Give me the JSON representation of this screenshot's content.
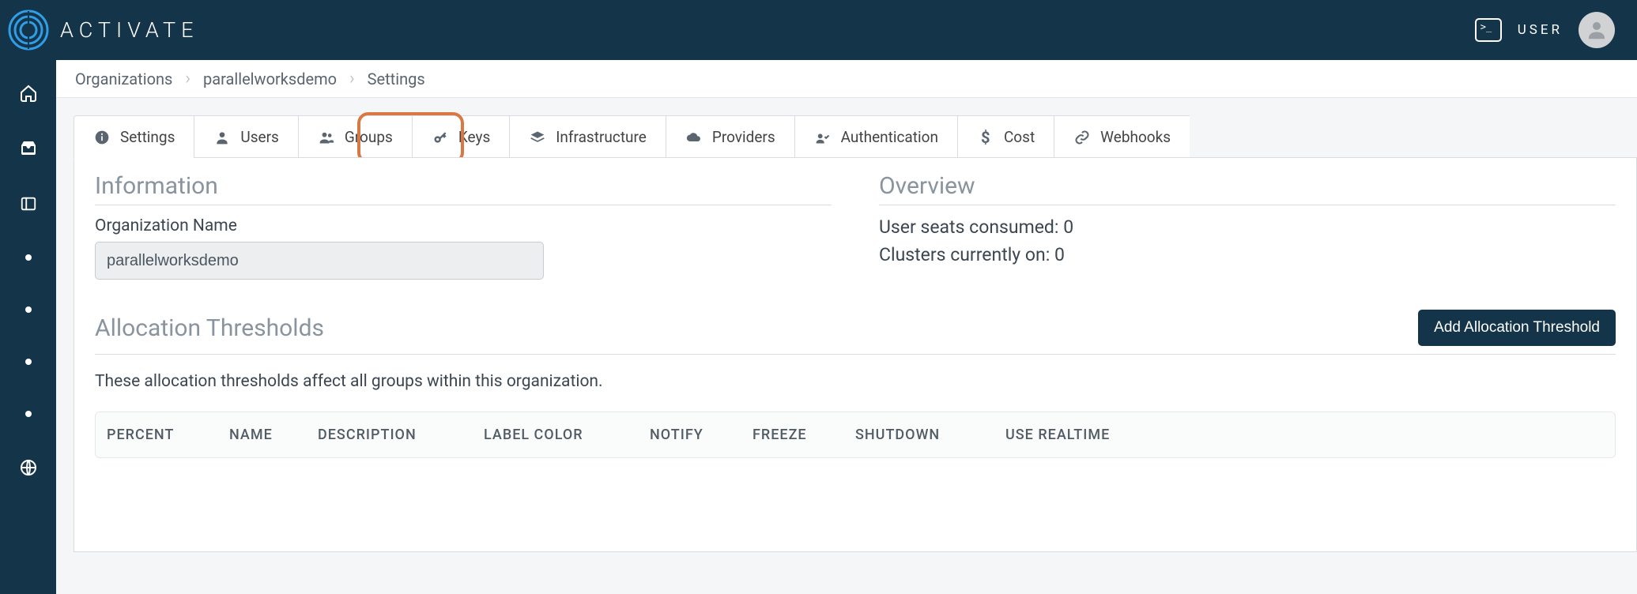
{
  "brand": {
    "name": "ACTIVATE"
  },
  "header": {
    "user_label": "USER"
  },
  "breadcrumb": {
    "items": [
      "Organizations",
      "parallelworksdemo",
      "Settings"
    ]
  },
  "tabs": [
    {
      "label": "Settings",
      "icon": "info"
    },
    {
      "label": "Users",
      "icon": "user"
    },
    {
      "label": "Groups",
      "icon": "users"
    },
    {
      "label": "Keys",
      "icon": "key"
    },
    {
      "label": "Infrastructure",
      "icon": "layers"
    },
    {
      "label": "Providers",
      "icon": "cloud"
    },
    {
      "label": "Authentication",
      "icon": "auth"
    },
    {
      "label": "Cost",
      "icon": "dollar"
    },
    {
      "label": "Webhooks",
      "icon": "link"
    }
  ],
  "information": {
    "title": "Information",
    "org_name_label": "Organization Name",
    "org_name_value": "parallelworksdemo"
  },
  "overview": {
    "title": "Overview",
    "seats_label": "User seats consumed:",
    "seats_value": "0",
    "clusters_label": "Clusters currently on:",
    "clusters_value": "0"
  },
  "thresholds": {
    "title": "Allocation Thresholds",
    "add_button": "Add Allocation Threshold",
    "description": "These allocation thresholds affect all groups within this organization.",
    "columns": {
      "percent": "PERCENT",
      "name": "NAME",
      "description": "DESCRIPTION",
      "label_color": "LABEL COLOR",
      "notify": "NOTIFY",
      "freeze": "FREEZE",
      "shutdown": "SHUTDOWN",
      "use_realtime": "USE REALTIME"
    }
  }
}
